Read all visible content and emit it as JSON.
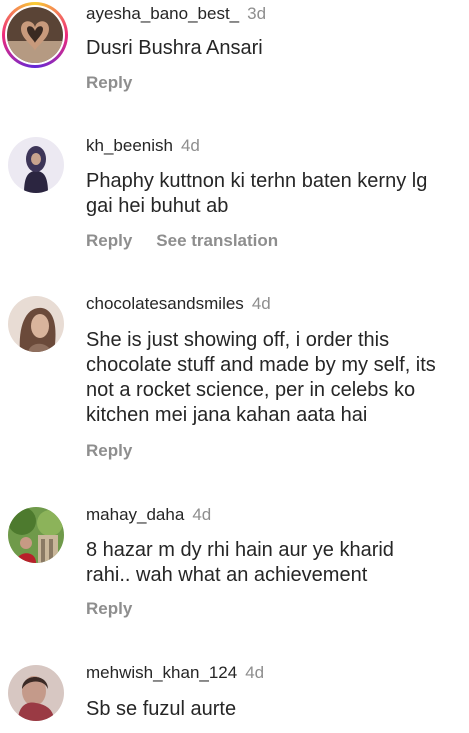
{
  "colors": {
    "text": "#262626",
    "muted": "#8e8e8e",
    "background": "#ffffff"
  },
  "comments": [
    {
      "username": "ayesha_bano_best_",
      "time": "3d",
      "text": "Dusri Bushra Ansari",
      "reply": "Reply"
    },
    {
      "username": "kh_beenish",
      "time": "4d",
      "text": "Phaphy kuttnon ki terhn baten kerny lg gai hei buhut ab",
      "reply": "Reply",
      "see_translation": "See translation"
    },
    {
      "username": "chocolatesandsmiles",
      "time": "4d",
      "text": "She is just showing off, i order this chocolate stuff and made by my self, its not a rocket science, per in celebs ko kitchen mei jana kahan aata hai",
      "reply": "Reply"
    },
    {
      "username": "mahay_daha",
      "time": "4d",
      "text": "8 hazar m dy rhi hain aur ye kharid rahi.. wah what an achievement",
      "reply": "Reply"
    },
    {
      "username": "mehwish_khan_124",
      "time": "4d",
      "text": "Sb se fuzul aurte"
    }
  ]
}
